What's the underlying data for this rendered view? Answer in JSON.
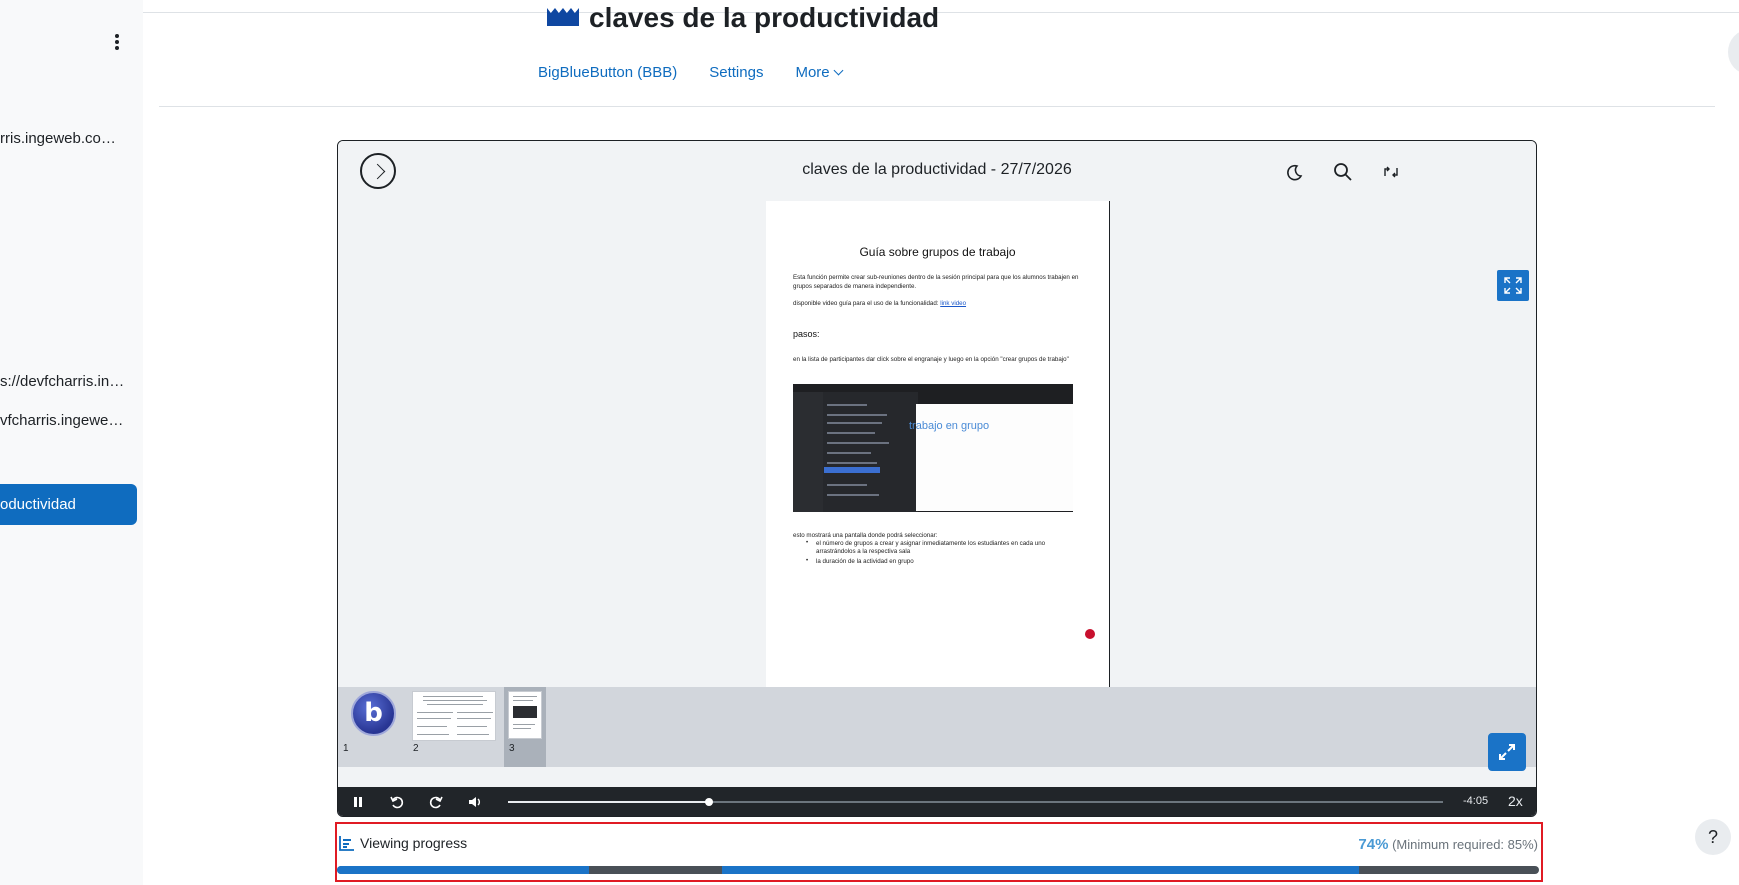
{
  "drawer": {
    "items": [
      {
        "label": "rris.ingeweb.com…"
      },
      {
        "label": "s://devfcharris.in…"
      },
      {
        "label": "vfcharris.ingewe…"
      }
    ],
    "active_label": "oductividad"
  },
  "page": {
    "title": "claves de la productividad"
  },
  "nav": {
    "items": [
      "BigBlueButton (BBB)",
      "Settings",
      "More"
    ]
  },
  "player": {
    "title": "claves de la productividad - 27/7/2026",
    "slide": {
      "title": "Guía sobre grupos de trabajo",
      "p1": "Esta función permite crear sub-reuniones dentro de la sesión principal para que los alumnos trabajen en grupos separados de manera independiente.",
      "p2_text": "disponible video guía para el uso de la funcionalidad: ",
      "p2_link": "link video",
      "heading": "pasos:",
      "p3": "en la lista de participantes dar click sobre el engranaje y luego en la opción \"crear grupos de trabajo\"",
      "shot_text": "trabajo en grupo",
      "p4": "esto mostrará una pantalla donde podrá seleccionar:",
      "bullets": [
        "el número de grupos a crear y asignar inmediatamente los estudiantes en cada uno arrastrándolos a la respectiva sala",
        "la duración de la actividad en grupo"
      ]
    },
    "thumbs": [
      {
        "num": "1",
        "logo": "b"
      },
      {
        "num": "2"
      },
      {
        "num": "3"
      }
    ],
    "controls": {
      "progress_fraction": 0.215,
      "time_remaining": "-4:05",
      "speed": "2x"
    }
  },
  "progress": {
    "label": "Viewing progress",
    "percent": "74%",
    "minimum": "(Minimum required: 85%)",
    "watched_segments": [
      [
        0.0,
        0.21
      ],
      [
        0.32,
        0.85
      ]
    ]
  },
  "help": {
    "label": "?"
  },
  "colors": {
    "accent": "#0f6cbf",
    "progress_blue": "#1a73c7",
    "highlight_border": "#e01b24"
  }
}
